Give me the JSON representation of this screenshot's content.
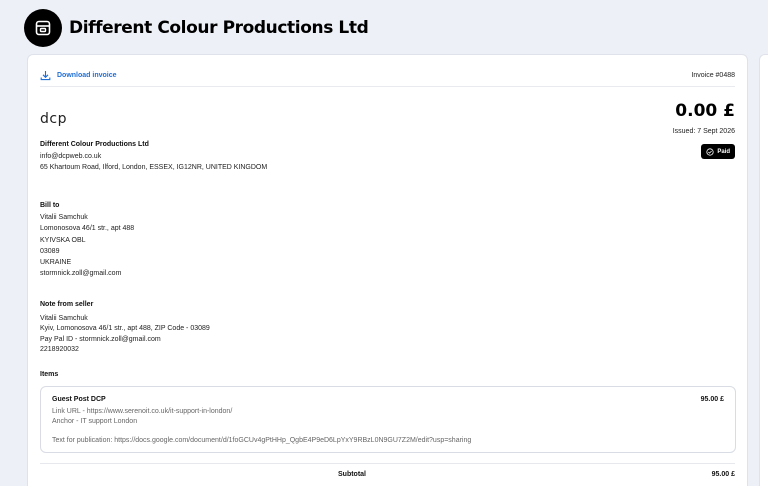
{
  "header": {
    "company": "Different Colour Productions Ltd"
  },
  "toolbar": {
    "download_label": "Download invoice",
    "invoice_number": "Invoice #0488"
  },
  "seller": {
    "logo_text": "dcp",
    "name": "Different Colour Productions Ltd",
    "email": "info@dcpweb.co.uk",
    "address": "65 Khartoum Road, Ilford, London, ESSEX, IG12NR, UNITED KINGDOM"
  },
  "summary": {
    "amount": "0.00 £",
    "issued": "Issued: 7 Sept 2026",
    "status": "Paid"
  },
  "bill_to": {
    "title": "Bill to",
    "lines": [
      "Vitalii Samchuk",
      "Lomonosova 46/1 str., apt 488",
      "KYIVSKA OBL",
      "03089",
      "UKRAINE",
      "stormnick.zoll@gmail.com"
    ]
  },
  "note": {
    "title": "Note from seller",
    "lines": [
      "Vitalii Samchuk",
      "Kyiv, Lomonosova 46/1 str., apt 488, ZIP Code - 03089",
      "Pay Pal ID - stormnick.zoll@gmail.com",
      "2218920032"
    ]
  },
  "items": {
    "title": "Items",
    "list": [
      {
        "name": "Guest Post DCP",
        "price": "95.00 £",
        "desc1": "Link URL - https://www.serenoit.co.uk/it-support-in-london/",
        "desc2": "Anchor - IT support London",
        "text": "Text for publication: https://docs.google.com/document/d/1foGCUv4gPtHHp_QgbE4P9eD6LpYxY9RBzL0N9GU7Z2M/edit?usp=sharing"
      }
    ]
  },
  "totals": {
    "subtotal_label": "Subtotal",
    "subtotal_value": "95.00 £"
  }
}
